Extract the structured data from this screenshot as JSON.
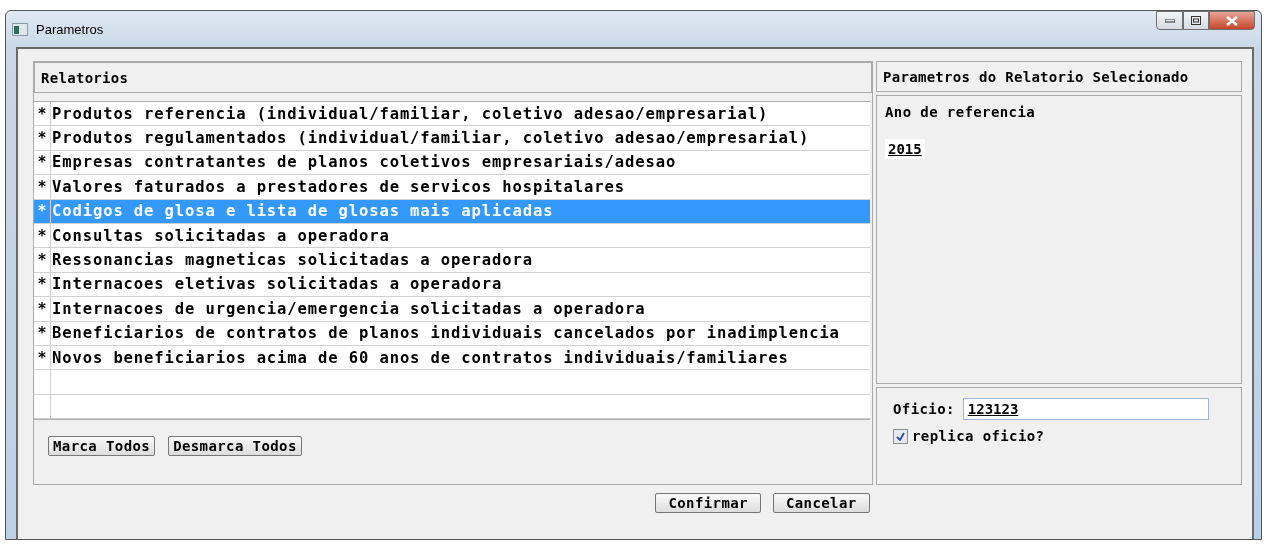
{
  "window": {
    "title": "Parametros"
  },
  "reports": {
    "header": "Relatorios",
    "items": [
      {
        "mark": "*",
        "label": "Produtos referencia (individual/familiar, coletivo adesao/empresarial)",
        "selected": false
      },
      {
        "mark": "*",
        "label": "Produtos regulamentados (individual/familiar, coletivo adesao/empresarial)",
        "selected": false
      },
      {
        "mark": "*",
        "label": "Empresas contratantes de planos coletivos empresariais/adesao",
        "selected": false
      },
      {
        "mark": "*",
        "label": "Valores faturados a prestadores de servicos hospitalares",
        "selected": false
      },
      {
        "mark": "*",
        "label": "Codigos de glosa e lista de glosas mais aplicadas",
        "selected": true
      },
      {
        "mark": "*",
        "label": "Consultas solicitadas a operadora",
        "selected": false
      },
      {
        "mark": "*",
        "label": "Ressonancias magneticas solicitadas a operadora",
        "selected": false
      },
      {
        "mark": "*",
        "label": "Internacoes eletivas solicitadas a operadora",
        "selected": false
      },
      {
        "mark": "*",
        "label": "Internacoes de urgencia/emergencia solicitadas a operadora",
        "selected": false
      },
      {
        "mark": "*",
        "label": "Beneficiarios de contratos de planos individuais cancelados por inadimplencia",
        "selected": false
      },
      {
        "mark": "*",
        "label": "Novos beneficiarios acima de 60 anos de contratos individuais/familiares",
        "selected": false
      }
    ],
    "buttons": [
      "Marca Todos",
      "Desmarca Todos"
    ]
  },
  "parameters": {
    "header": "Parametros do Relatorio Selecionado",
    "year_label": "Ano de referencia",
    "year_value": "2015"
  },
  "oficio": {
    "label": "Oficio:",
    "value": "123123",
    "replicate": {
      "label": "replica oficio?",
      "checked": true
    }
  },
  "buttons": [
    "Confirmar",
    "Cancelar"
  ]
}
